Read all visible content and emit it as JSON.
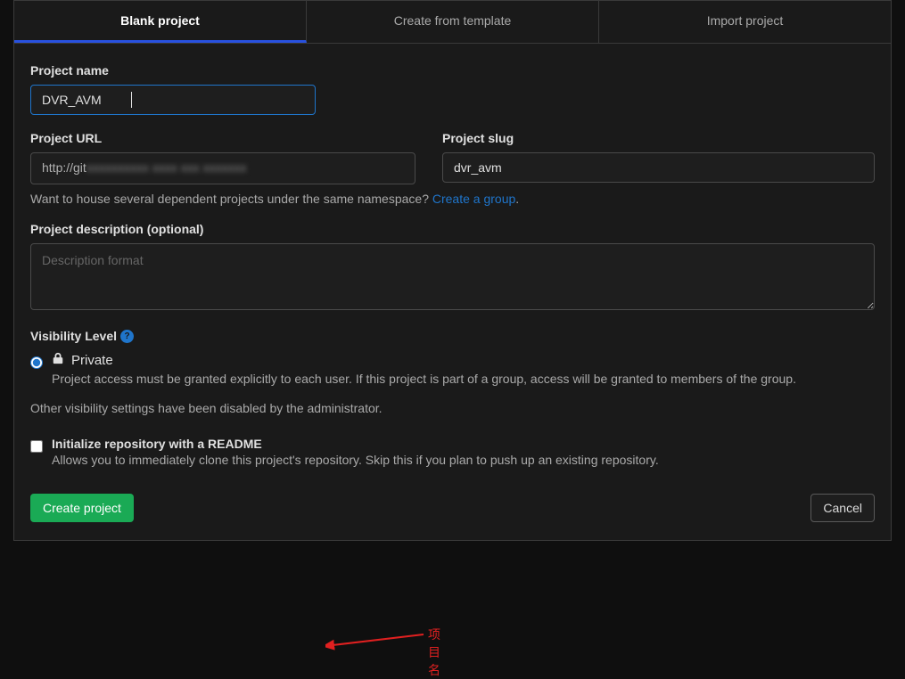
{
  "tabs": {
    "blank": "Blank project",
    "template": "Create from template",
    "import": "Import project"
  },
  "form": {
    "project_name_label": "Project name",
    "project_name_value": "DVR_AVM",
    "project_url_label": "Project URL",
    "project_url_prefix": "http://git",
    "project_slug_label": "Project slug",
    "project_slug_value": "dvr_avm",
    "namespace_helper": "Want to house several dependent projects under the same namespace? ",
    "namespace_link": "Create a group",
    "namespace_period": ".",
    "description_label": "Project description (optional)",
    "description_placeholder": "Description format",
    "visibility_label": "Visibility Level",
    "private_title": "Private",
    "private_desc": "Project access must be granted explicitly to each user. If this project is part of a group, access will be granted to members of the group.",
    "visibility_disabled_note": "Other visibility settings have been disabled by the administrator.",
    "readme_title": "Initialize repository with a README",
    "readme_desc": "Allows you to immediately clone this project's repository. Skip this if you plan to push up an existing repository.",
    "create_button": "Create project",
    "cancel_button": "Cancel"
  },
  "annotation": {
    "text": "项目名"
  }
}
